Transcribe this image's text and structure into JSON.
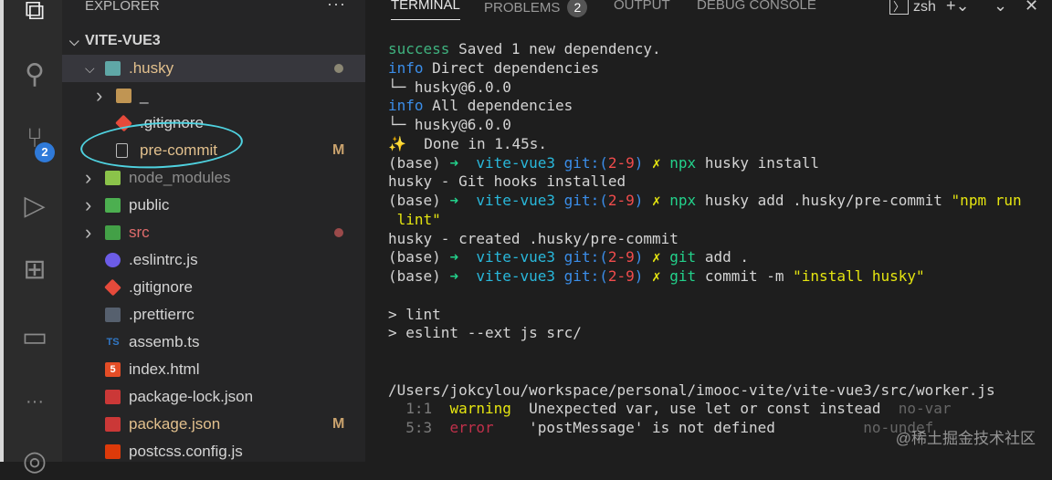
{
  "activity_bar": {
    "scm_badge": "2"
  },
  "explorer": {
    "title": "EXPLORER",
    "more": "···",
    "root": "VITE-VUE3",
    "items": [
      {
        "label": ".husky",
        "indent": 1,
        "kind": "folder-open",
        "icon": "husky-folder-icon",
        "icon_color": "#5fa7a6",
        "color": "#e2c08d",
        "decoration": "dot",
        "deco_color": "#8b8774",
        "selected": true
      },
      {
        "label": "_",
        "indent": 2,
        "kind": "folder",
        "icon": "folder-icon",
        "icon_color": "#c09553",
        "color": "#d4d4d4"
      },
      {
        "label": ".gitignore",
        "indent": 2,
        "kind": "file",
        "icon": "git-icon",
        "icon_color": "#e64a3b",
        "color": "#d4d4d4"
      },
      {
        "label": "pre-commit",
        "indent": 2,
        "kind": "file",
        "icon": "file-icon",
        "icon_color": "#bbbbbb",
        "color": "#e2c08d",
        "decoration": "M",
        "deco_color": "#c9a26d"
      },
      {
        "label": "node_modules",
        "indent": 1,
        "kind": "folder",
        "icon": "node-folder-icon",
        "icon_color": "#8bc34a",
        "color": "#8c8c8c"
      },
      {
        "label": "public",
        "indent": 1,
        "kind": "folder",
        "icon": "public-folder-icon",
        "icon_color": "#4caf50",
        "color": "#d4d4d4"
      },
      {
        "label": "src",
        "indent": 1,
        "kind": "folder",
        "icon": "src-folder-icon",
        "icon_color": "#43a047",
        "color": "#e06c6c",
        "decoration": "dot",
        "deco_color": "#9b4a4a"
      },
      {
        "label": ".eslintrc.js",
        "indent": 1,
        "kind": "file",
        "icon": "eslint-icon",
        "icon_color": "#6c5ce7",
        "color": "#d4d4d4"
      },
      {
        "label": ".gitignore",
        "indent": 1,
        "kind": "file",
        "icon": "git-icon",
        "icon_color": "#e64a3b",
        "color": "#d4d4d4"
      },
      {
        "label": ".prettierrc",
        "indent": 1,
        "kind": "file",
        "icon": "prettier-icon",
        "icon_color": "#56606e",
        "color": "#d4d4d4"
      },
      {
        "label": "assemb.ts",
        "indent": 1,
        "kind": "file",
        "icon": "typescript-icon",
        "icon_color": "#3178c6",
        "color": "#d4d4d4",
        "glyph": "TS"
      },
      {
        "label": "index.html",
        "indent": 1,
        "kind": "file",
        "icon": "html5-icon",
        "icon_color": "#e44d26",
        "color": "#d4d4d4",
        "glyph": "5"
      },
      {
        "label": "package-lock.json",
        "indent": 1,
        "kind": "file",
        "icon": "npm-icon",
        "icon_color": "#cb3837",
        "color": "#d4d4d4"
      },
      {
        "label": "package.json",
        "indent": 1,
        "kind": "file",
        "icon": "npm-icon",
        "icon_color": "#cb3837",
        "color": "#e2c08d",
        "decoration": "M",
        "deco_color": "#c9a26d"
      },
      {
        "label": "postcss.config.js",
        "indent": 1,
        "kind": "file",
        "icon": "postcss-icon",
        "icon_color": "#dd3a0a",
        "color": "#d4d4d4"
      }
    ]
  },
  "panel": {
    "tabs": [
      {
        "label": "TERMINAL",
        "active": true
      },
      {
        "label": "PROBLEMS",
        "badge": "2"
      },
      {
        "label": "OUTPUT"
      },
      {
        "label": "DEBUG CONSOLE"
      }
    ],
    "shell": "zsh"
  },
  "terminal": {
    "lines": [
      [
        [
          "success",
          "#3fb27f"
        ],
        [
          " Saved 1 new dependency.",
          ""
        ]
      ],
      [
        [
          "info",
          "#3b8eea"
        ],
        [
          " Direct dependencies",
          ""
        ]
      ],
      [
        [
          "└─ husky@6.0.0",
          ""
        ]
      ],
      [
        [
          "info",
          "#3b8eea"
        ],
        [
          " All dependencies",
          ""
        ]
      ],
      [
        [
          "└─ husky@6.0.0",
          ""
        ]
      ],
      [
        [
          "✨",
          "#e5e510"
        ],
        [
          "  Done in 1.45s.",
          ""
        ]
      ],
      [
        [
          "(base) ",
          ""
        ],
        [
          "➜  ",
          "#23d18b"
        ],
        [
          "vite-vue3 ",
          "#29b8db"
        ],
        [
          "git:(",
          "#3b8eea"
        ],
        [
          "2-9",
          "#f14c4c"
        ],
        [
          ") ",
          "#3b8eea"
        ],
        [
          "✗ ",
          "#e5e510"
        ],
        [
          "npx",
          "#23d18b"
        ],
        [
          " husky install",
          ""
        ]
      ],
      [
        [
          "husky - Git hooks installed",
          ""
        ]
      ],
      [
        [
          "(base) ",
          ""
        ],
        [
          "➜  ",
          "#23d18b"
        ],
        [
          "vite-vue3 ",
          "#29b8db"
        ],
        [
          "git:(",
          "#3b8eea"
        ],
        [
          "2-9",
          "#f14c4c"
        ],
        [
          ") ",
          "#3b8eea"
        ],
        [
          "✗ ",
          "#e5e510"
        ],
        [
          "npx",
          "#23d18b"
        ],
        [
          " husky add .husky/pre-commit ",
          ""
        ],
        [
          "\"npm run",
          "#e5e510"
        ]
      ],
      [
        [
          " lint\"",
          "#e5e510"
        ]
      ],
      [
        [
          "husky - created .husky/pre-commit",
          ""
        ]
      ],
      [
        [
          "(base) ",
          ""
        ],
        [
          "➜  ",
          "#23d18b"
        ],
        [
          "vite-vue3 ",
          "#29b8db"
        ],
        [
          "git:(",
          "#3b8eea"
        ],
        [
          "2-9",
          "#f14c4c"
        ],
        [
          ") ",
          "#3b8eea"
        ],
        [
          "✗ ",
          "#e5e510"
        ],
        [
          "git",
          "#23d18b"
        ],
        [
          " add .",
          ""
        ]
      ],
      [
        [
          "(base) ",
          ""
        ],
        [
          "➜  ",
          "#23d18b"
        ],
        [
          "vite-vue3 ",
          "#29b8db"
        ],
        [
          "git:(",
          "#3b8eea"
        ],
        [
          "2-9",
          "#f14c4c"
        ],
        [
          ") ",
          "#3b8eea"
        ],
        [
          "✗ ",
          "#e5e510"
        ],
        [
          "git",
          "#23d18b"
        ],
        [
          " commit -m ",
          ""
        ],
        [
          "\"install husky\"",
          "#e5e510"
        ]
      ],
      [],
      [
        [
          "> lint",
          ""
        ]
      ],
      [
        [
          "> eslint --ext js src/",
          ""
        ]
      ],
      [],
      [],
      [
        [
          "/Users/jokcylou/workspace/personal/imooc-vite/vite-vue3/src/worker.js",
          ""
        ]
      ],
      [
        [
          "  1:1  ",
          "#7a7a7a"
        ],
        [
          "warning",
          "#e5e510"
        ],
        [
          "  Unexpected var, use let or const instead  ",
          ""
        ],
        [
          "no-var",
          "#666666"
        ]
      ],
      [
        [
          "  5:3  ",
          "#7a7a7a"
        ],
        [
          "error",
          "#c0304a"
        ],
        [
          "    'postMessage' is not defined          ",
          ""
        ],
        [
          "no-undef",
          "#666666"
        ]
      ]
    ]
  },
  "watermark": "@稀土掘金技术社区"
}
